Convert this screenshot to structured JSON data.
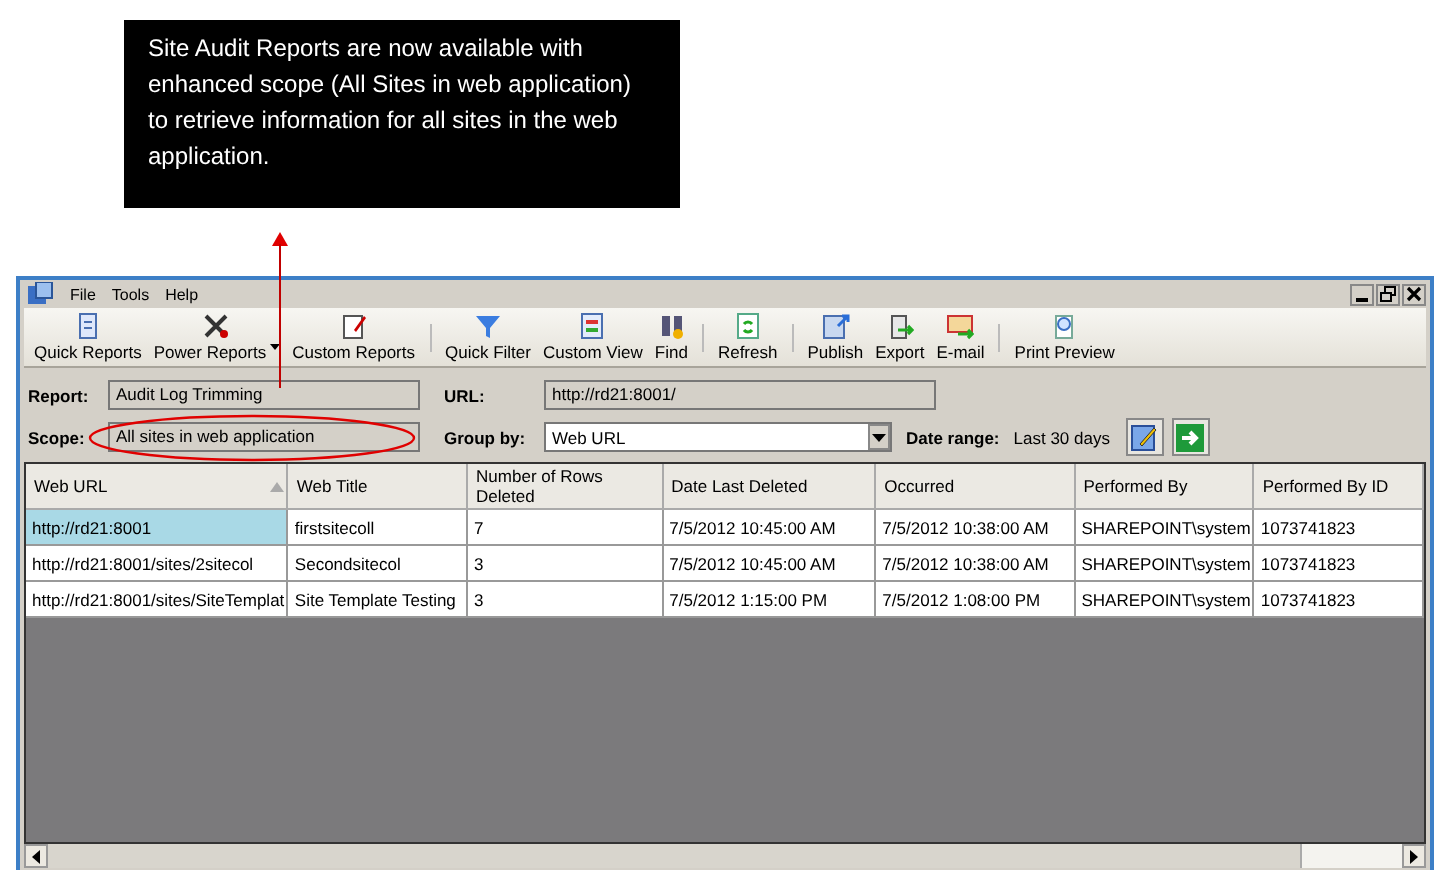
{
  "callout": {
    "text": "Site Audit Reports are now available with enhanced scope (All Sites in web application) to retrieve information for all sites in the web application."
  },
  "menu": [
    "File",
    "Tools",
    "Help"
  ],
  "toolbar": [
    {
      "label": "Quick Reports",
      "dropdown": false
    },
    {
      "label": "Power Reports",
      "dropdown": true
    },
    {
      "label": "Custom Reports",
      "dropdown": false
    },
    {
      "label": "Quick Filter",
      "dropdown": false
    },
    {
      "label": "Custom View",
      "dropdown": false
    },
    {
      "label": "Find",
      "dropdown": false
    },
    {
      "label": "Refresh",
      "dropdown": false
    },
    {
      "label": "Publish",
      "dropdown": false
    },
    {
      "label": "Export",
      "dropdown": false
    },
    {
      "label": "E-mail",
      "dropdown": false
    },
    {
      "label": "Print Preview",
      "dropdown": false
    }
  ],
  "report": {
    "label": "Report:",
    "value": "Audit Log Trimming"
  },
  "url": {
    "label": "URL:",
    "value": "http://rd21:8001/"
  },
  "scope": {
    "label": "Scope:",
    "value": "All sites in web application",
    "highlighted": true
  },
  "group_by": {
    "label": "Group by:",
    "value": "Web URL"
  },
  "date_range": {
    "label": "Date range:",
    "value": "Last 30 days"
  },
  "table": {
    "columns": [
      "Web URL",
      "Web Title",
      "Number of Rows Deleted",
      "Date Last Deleted",
      "Occurred",
      "Performed By",
      "Performed By ID"
    ],
    "rows": [
      {
        "selected": true,
        "cells": [
          "http://rd21:8001",
          "firstsitecoll",
          "7",
          "7/5/2012 10:45:00 AM",
          "7/5/2012 10:38:00 AM",
          "SHAREPOINT\\system",
          "1073741823"
        ]
      },
      {
        "selected": false,
        "cells": [
          "http://rd21:8001/sites/2sitecol",
          "Secondsitecol",
          "3",
          "7/5/2012 10:45:00 AM",
          "7/5/2012 10:38:00 AM",
          "SHAREPOINT\\system",
          "1073741823"
        ]
      },
      {
        "selected": false,
        "cells": [
          "http://rd21:8001/sites/SiteTemplat",
          "Site Template Testing",
          "3",
          "7/5/2012 1:15:00 PM",
          "7/5/2012 1:08:00 PM",
          "SHAREPOINT\\system",
          "1073741823"
        ]
      }
    ]
  }
}
